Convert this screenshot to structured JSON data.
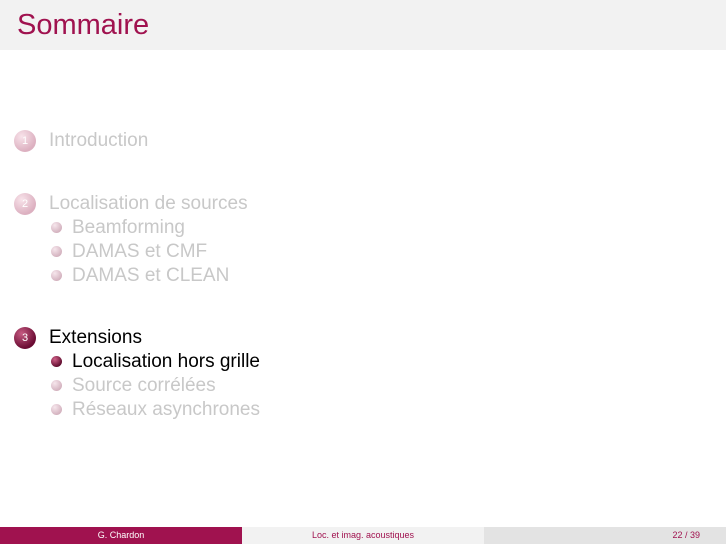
{
  "slide": {
    "title": "Sommaire"
  },
  "toc": {
    "sections": [
      {
        "number": "1",
        "label": "Introduction",
        "active": false,
        "subsections": []
      },
      {
        "number": "2",
        "label": "Localisation de sources",
        "active": false,
        "subsections": [
          {
            "label": "Beamforming",
            "active": false
          },
          {
            "label": "DAMAS et CMF",
            "active": false
          },
          {
            "label": "DAMAS et CLEAN",
            "active": false
          }
        ]
      },
      {
        "number": "3",
        "label": "Extensions",
        "active": true,
        "subsections": [
          {
            "label": "Localisation hors grille",
            "active": true
          },
          {
            "label": "Source corrélées",
            "active": false
          },
          {
            "label": "Réseaux asynchrones",
            "active": false
          }
        ]
      }
    ]
  },
  "footer": {
    "author": "G. Chardon",
    "short_title": "Loc. et imag. acoustiques",
    "page": "22 / 39"
  },
  "colors": {
    "accent": "#a0124f",
    "dimmed_text": "#c8c8c8",
    "title_bar": "#f2f2f2"
  }
}
